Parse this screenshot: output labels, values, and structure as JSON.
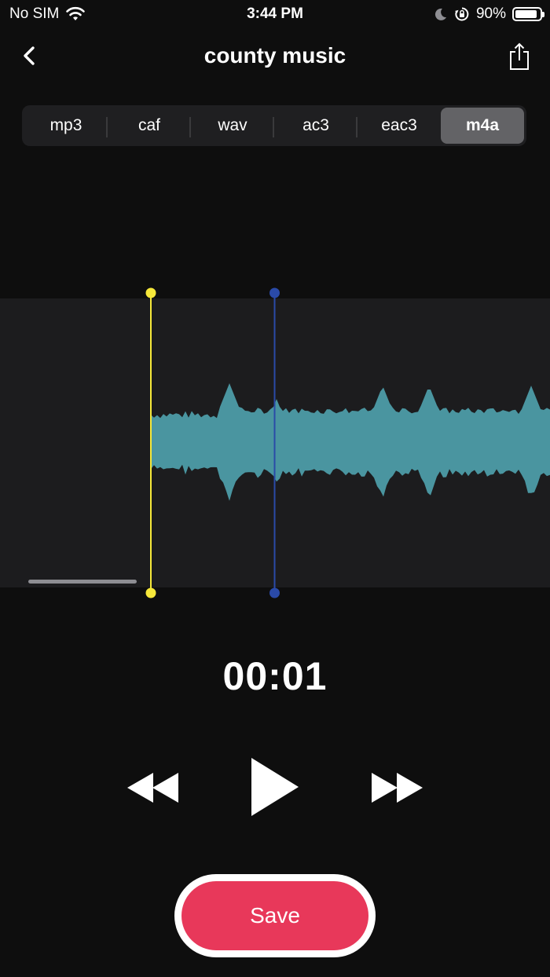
{
  "status_bar": {
    "carrier": "No SIM",
    "time": "3:44 PM",
    "battery": "90%",
    "battery_level": 0.9,
    "icons": [
      "wifi-icon",
      "moon-icon",
      "orientation-lock-icon",
      "battery-icon"
    ]
  },
  "nav": {
    "title": "county music",
    "back_icon": "chevron-left-icon",
    "share_icon": "share-icon"
  },
  "formats": {
    "options": [
      "mp3",
      "caf",
      "wav",
      "ac3",
      "eac3",
      "m4a"
    ],
    "selected": "m4a"
  },
  "player": {
    "time": "00:01",
    "controls": [
      "rewind-icon",
      "play-icon",
      "fast-forward-icon"
    ]
  },
  "actions": {
    "save_label": "Save"
  },
  "colors": {
    "background": "#0e0e0e",
    "waveform": "#4a95a0",
    "start_marker": "#f6e83a",
    "playhead": "#2a4aa8",
    "save": "#e8385a",
    "segment_selected": "#636366"
  }
}
